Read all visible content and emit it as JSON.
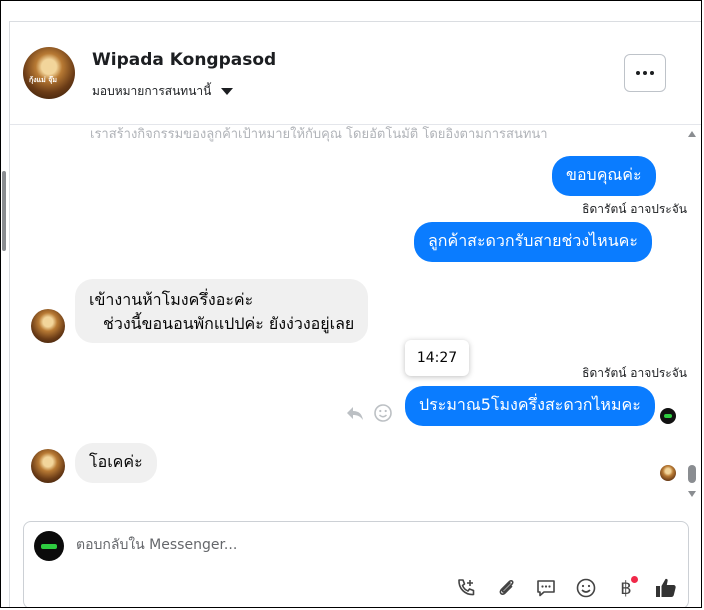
{
  "header": {
    "contact_name": "Wipada Kongpasod",
    "assign_label": "มอบหมายการสนทนานี้",
    "avatar_text": "กุ้งแม่ จุ๊ม"
  },
  "chat": {
    "faded_text": "เราสร้างกิจกรรมของลูกค้าเป้าหมายให้กับคุณ โดยอัตโนมัติ โดยอิงตามการสนทนา",
    "messages": [
      {
        "text": "ขอบคุณค่ะ"
      },
      {
        "sender": "ธิดารัตน์ อาจประจัน"
      },
      {
        "text": "ลูกค้าสะดวกรับสายช่วงไหนคะ"
      },
      {
        "line1": "เข้างานห้าโมงครึ่งอะค่ะ",
        "line2": "ช่วงนี้ขอนอนพักแปปค่ะ ยังง่วงอยู่เลย"
      },
      {
        "tooltip": "14:27"
      },
      {
        "sender": "ธิดารัตน์ อาจประจัน"
      },
      {
        "text": "ประมาณ5โมงครึ่งสะดวกไหมคะ"
      },
      {
        "text": "โอเคค่ะ"
      }
    ]
  },
  "composer": {
    "placeholder": "ตอบกลับใน Messenger...",
    "tools": [
      "call-add-icon",
      "attachment-icon",
      "saved-reply-icon",
      "emoji-icon",
      "baht-payment-icon",
      "like-icon"
    ],
    "baht_symbol": "฿"
  },
  "colors": {
    "outgoing": "#0a7cff",
    "incoming": "#f0f0f0",
    "notification": "#f02849"
  }
}
